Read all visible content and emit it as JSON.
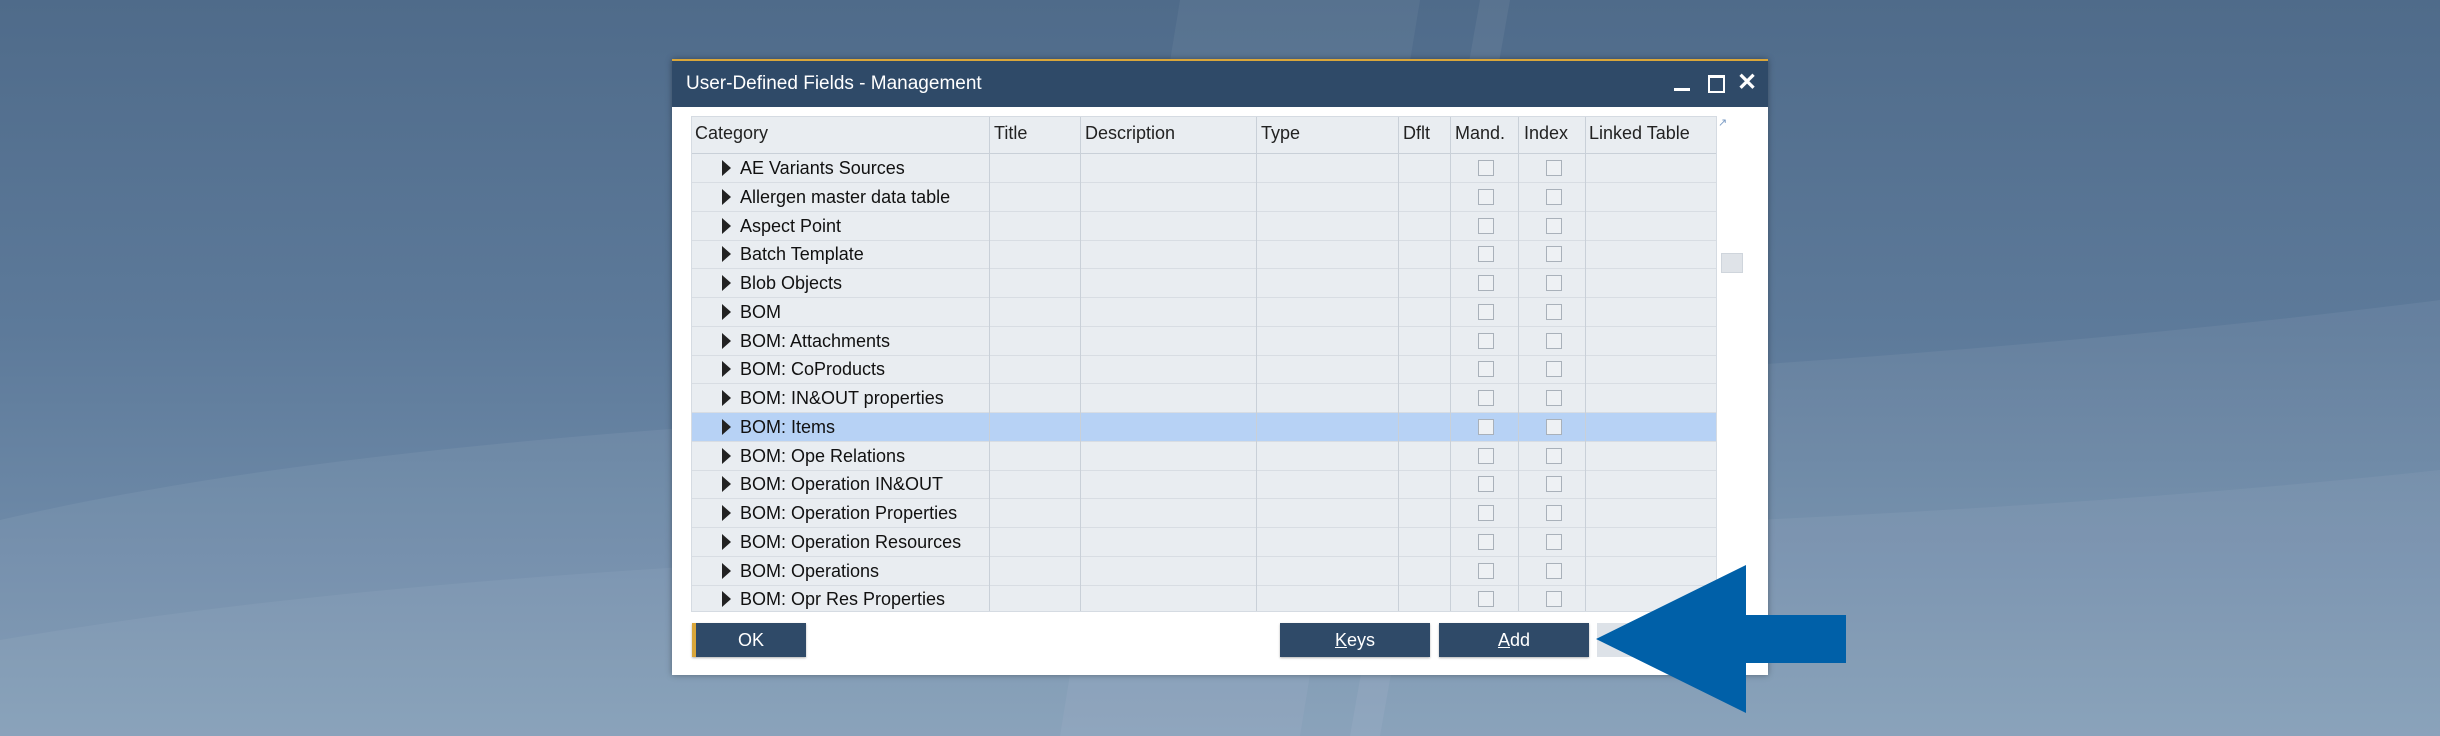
{
  "window": {
    "title": "User-Defined Fields - Management"
  },
  "table": {
    "columns": [
      "Category",
      "Title",
      "Description",
      "Type",
      "Dflt",
      "Mand.",
      "Index",
      "Linked Table"
    ],
    "rows": [
      "AE Variants Sources",
      "Allergen master data table",
      "Aspect Point",
      "Batch Template",
      "Blob Objects",
      "BOM",
      "BOM: Attachments",
      "BOM: CoProducts",
      "BOM: IN&OUT properties",
      "BOM: Items",
      "BOM: Ope Relations",
      "BOM: Operation IN&OUT",
      "BOM: Operation Properties",
      "BOM: Operation Resources",
      "BOM: Operations",
      "BOM: Opr Res Properties"
    ],
    "selected_row": "BOM: Items"
  },
  "buttons": {
    "ok": "OK",
    "keys_underline": "K",
    "keys_rest": "eys",
    "add_underline": "A",
    "add_rest": "dd"
  },
  "colors": {
    "titlebar": "#2f4a68",
    "selected_row": "#b7d2f5",
    "annotation_arrow": "#0060a8",
    "accent": "#d9a63a"
  }
}
